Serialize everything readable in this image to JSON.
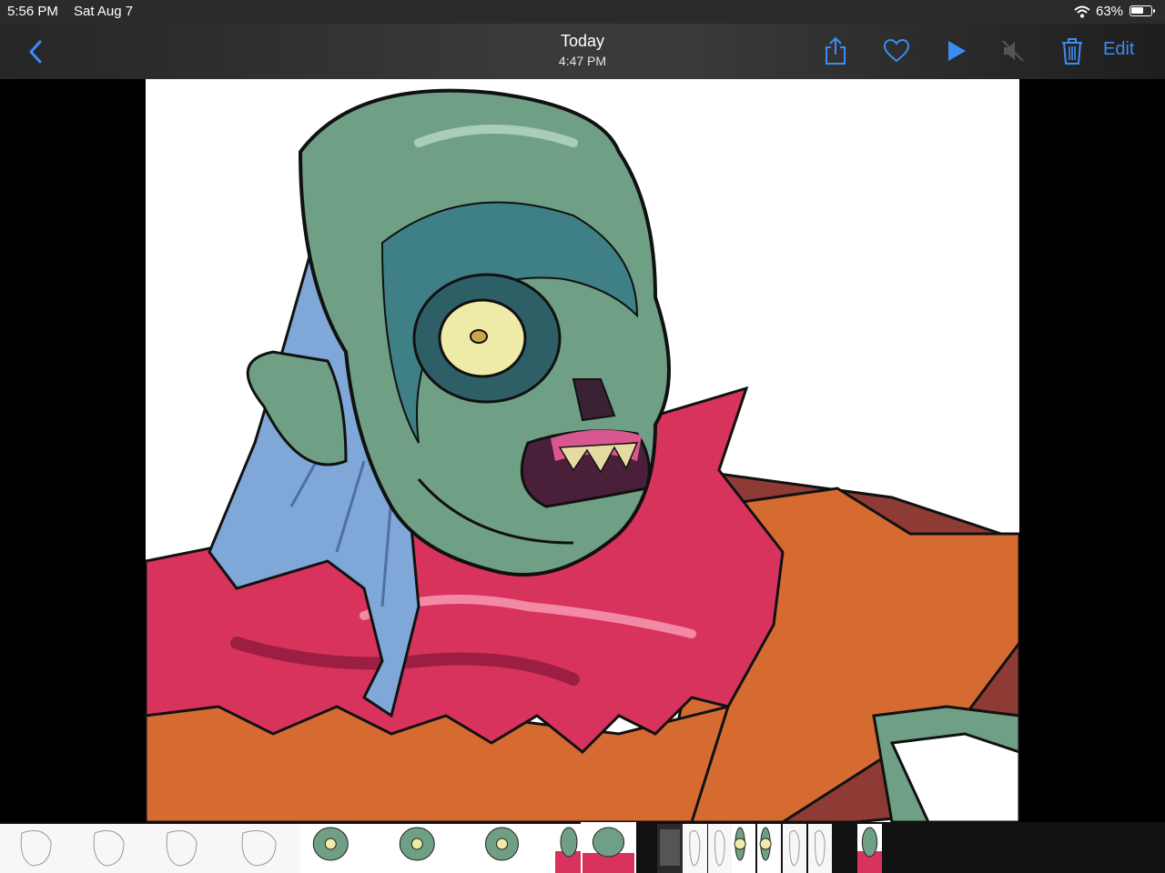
{
  "status": {
    "time": "5:56 PM",
    "date": "Sat Aug 7",
    "battery": "63%"
  },
  "nav": {
    "title": "Today",
    "subtitle": "4:47 PM",
    "edit_label": "Edit",
    "icons": [
      "chevron-left-icon",
      "share-icon",
      "heart-icon",
      "play-icon",
      "speaker-muted-icon",
      "trash-icon"
    ]
  },
  "colors": {
    "accent": "#3b8df5",
    "skin": "#6f9f84",
    "skin_shadow": "#3f7f86",
    "hair": "#7fa7d8",
    "scarf": "#d8335d",
    "robe": "#d66b32",
    "robe_dark": "#8e3a35"
  },
  "filmstrip": {
    "thumbnails": [
      "sketch",
      "sketch",
      "sketch",
      "sketch",
      "zombie-color",
      "zombie-color",
      "zombie-color",
      "zombie-full",
      "zombie-selected",
      "ui-screenshot",
      "sketch",
      "sketch",
      "zombie-color",
      "zombie-color",
      "sketch",
      "sketch",
      "zombie-full"
    ]
  }
}
